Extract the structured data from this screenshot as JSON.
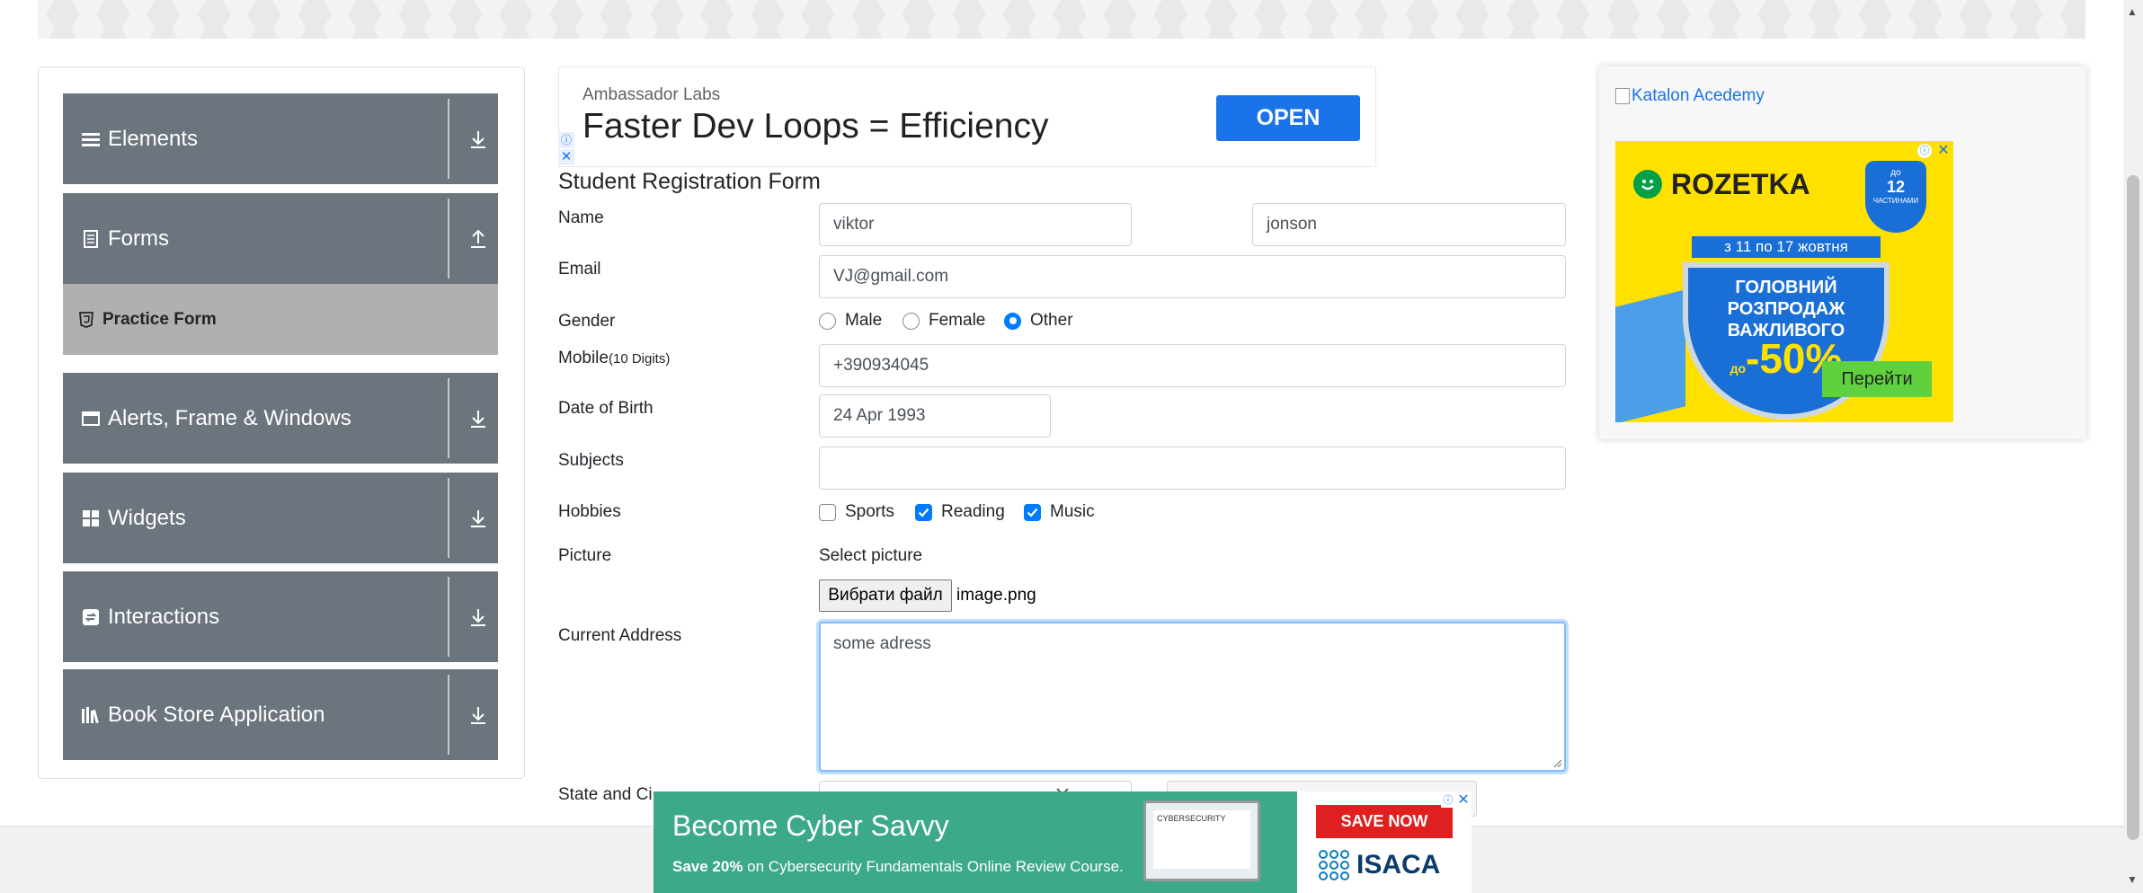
{
  "sidebar": {
    "groups": [
      {
        "label": "Elements",
        "icon": "menu-lines-icon",
        "arrow": "download-arrow-icon"
      },
      {
        "label": "Forms",
        "icon": "form-icon",
        "arrow": "upload-arrow-icon"
      },
      {
        "label": "Alerts, Frame & Windows",
        "icon": "window-icon",
        "arrow": "download-arrow-icon"
      },
      {
        "label": "Widgets",
        "icon": "grid-icon",
        "arrow": "download-arrow-icon"
      },
      {
        "label": "Interactions",
        "icon": "interaction-icon",
        "arrow": "download-arrow-icon"
      },
      {
        "label": "Book Store Application",
        "icon": "books-icon",
        "arrow": "download-arrow-icon"
      }
    ],
    "active_item": {
      "label": "Practice Form",
      "icon": "html5-icon"
    }
  },
  "top_ad": {
    "sponsor": "Ambassador Labs",
    "headline": "Faster Dev Loops = Efficiency",
    "button": "OPEN",
    "info_glyph": "ⓘ",
    "close_glyph": "✕"
  },
  "form": {
    "title": "Student Registration Form",
    "labels": {
      "name": "Name",
      "email": "Email",
      "gender": "Gender",
      "mobile": "Mobile",
      "mobile_hint": "(10 Digits)",
      "dob": "Date of Birth",
      "subjects": "Subjects",
      "hobbies": "Hobbies",
      "picture": "Picture",
      "address": "Current Address",
      "state_city": "State and Ci"
    },
    "first_name": "viktor",
    "last_name": "jonson",
    "email": "VJ@gmail.com",
    "gender_options": [
      {
        "label": "Male",
        "selected": false
      },
      {
        "label": "Female",
        "selected": false
      },
      {
        "label": "Other",
        "selected": true
      }
    ],
    "mobile": "+390934045",
    "dob": "24 Apr 1993",
    "subjects": "",
    "hobbies": [
      {
        "label": "Sports",
        "checked": false
      },
      {
        "label": "Reading",
        "checked": true
      },
      {
        "label": "Music",
        "checked": true
      }
    ],
    "select_picture": "Select picture",
    "file_button": "Вибрати файл",
    "file_name": "image.png",
    "address": "some adress"
  },
  "right_ad": {
    "katalon_alt": "Katalon Acedemy",
    "brand": "ROZETKA",
    "dates": "з 11 по 17 жовтня",
    "headline": "ГОЛОВНИЙ РОЗПРОДАЖ ВАЖЛИВОГО",
    "discount_prefix": "до",
    "discount": "-50%",
    "badge_top": "до",
    "badge_num": "12",
    "badge_bottom": "ЧАСТИНАМИ",
    "button": "Перейти"
  },
  "bottom_ad": {
    "headline": "Become Cyber Savvy",
    "sub_bold": "Save 20%",
    "sub_rest": " on Cybersecurity Fundamentals Online Review Course.",
    "cert_text": "CYBERSECURITY",
    "button": "SAVE NOW",
    "brand": "ISACA"
  },
  "colors": {
    "sidebar_bg": "#6c757d",
    "active_item_bg": "#b0b0b0",
    "primary": "#007bff",
    "open_button": "#1a73e8",
    "bottom_ad_bg": "#3ca98b",
    "rozetka_yellow": "#ffe100"
  }
}
